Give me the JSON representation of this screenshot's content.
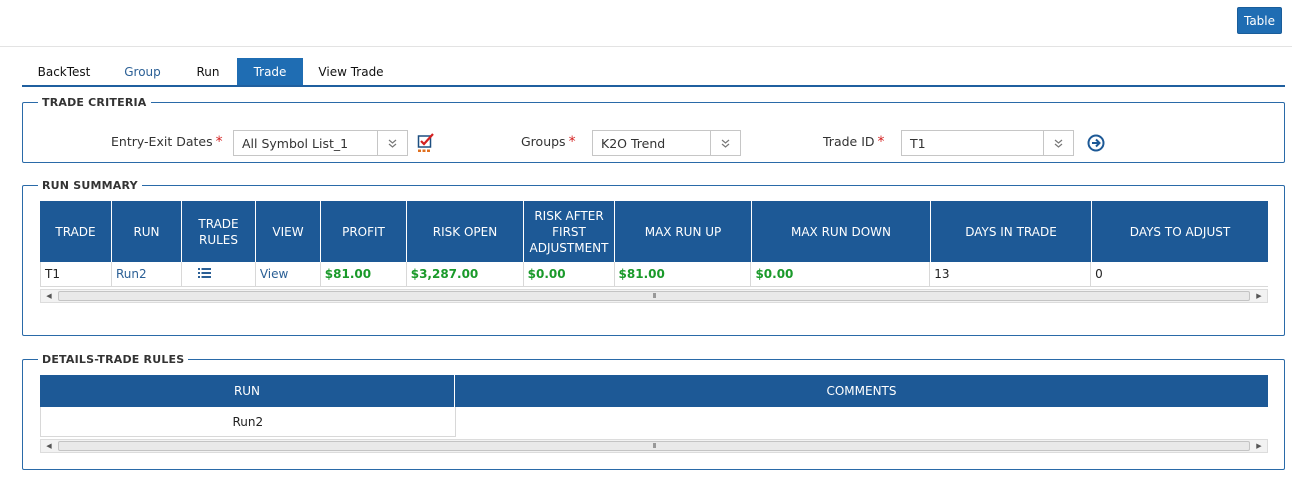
{
  "header": {
    "table_button": "Table"
  },
  "tabs": [
    {
      "label": "BackTest"
    },
    {
      "label": "Group"
    },
    {
      "label": "Run"
    },
    {
      "label": "Trade"
    },
    {
      "label": "View Trade"
    }
  ],
  "criteria": {
    "legend": "TRADE CRITERIA",
    "entry_exit_label": "Entry-Exit Dates",
    "entry_exit_value": "All Symbol List_1",
    "groups_label": "Groups",
    "groups_value": "K2O Trend",
    "trade_id_label": "Trade ID",
    "trade_id_value": "T1",
    "required_mark": "*"
  },
  "run_summary": {
    "legend": "RUN SUMMARY",
    "columns": [
      "TRADE",
      "RUN",
      "TRADE RULES",
      "VIEW",
      "PROFIT",
      "RISK OPEN",
      "RISK AFTER FIRST ADJUSTMENT",
      "MAX RUN UP",
      "MAX RUN DOWN",
      "DAYS IN TRADE",
      "DAYS TO ADJUST"
    ],
    "row": {
      "trade": "T1",
      "run": "Run2",
      "view": "View",
      "profit": "$81.00",
      "risk_open": "$3,287.00",
      "risk_after_first_adjustment": "$0.00",
      "max_run_up": "$81.00",
      "max_run_down": "$0.00",
      "days_in_trade": "13",
      "days_to_adjust": "0"
    }
  },
  "details": {
    "legend": "DETAILS-TRADE RULES",
    "columns": [
      "RUN",
      "COMMENTS"
    ],
    "row": {
      "run": "Run2",
      "comments": ""
    }
  },
  "scrollbar": {
    "thumb_grip": "III"
  },
  "colors": {
    "accent": "#1f6db3",
    "header": "#1d5996",
    "money": "#1a9a2a",
    "required": "#d42020"
  }
}
